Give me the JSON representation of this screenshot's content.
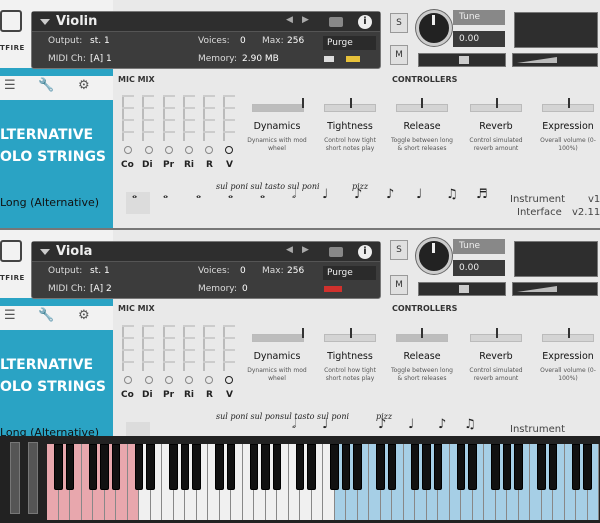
{
  "instruments": [
    {
      "name": "Violin",
      "output_label": "Output:",
      "output_value": "st. 1",
      "midi_label": "MIDI Ch:",
      "midi_value": "[A] 1",
      "voices_label": "Voices:",
      "voices_value": "0",
      "max_label": "Max:",
      "max_value": "256",
      "memory_label": "Memory:",
      "memory_value": "2.90 MB",
      "purge_label": "Purge",
      "tune_label": "Tune",
      "tune_value": "0.00",
      "solo_label": "S",
      "mute_label": "M",
      "pan_l": "L",
      "pan_r": "R",
      "mic_mix_label": "MIC MIX",
      "controllers_label": "CONTROLLERS",
      "mics": [
        "Co",
        "Di",
        "Pr",
        "Ri",
        "R",
        "V"
      ],
      "controllers": [
        {
          "name": "Dynamics",
          "desc": "Dynamics with mod wheel"
        },
        {
          "name": "Tightness",
          "desc": "Control how tight short notes play"
        },
        {
          "name": "Release",
          "desc": "Toggle between long & short releases"
        },
        {
          "name": "Reverb",
          "desc": "Control simulated reverb amount"
        },
        {
          "name": "Expression",
          "desc": "Overall volume (0-100%)"
        }
      ],
      "sidebar_title_1": "LTERNATIVE",
      "sidebar_title_2": "OLO STRINGS",
      "articulation": "Long (Alternative)",
      "art_text_1": "sul poni sul tasto sul poni",
      "art_text_2": "pizz",
      "instrument_label": "Instrument",
      "instrument_value": "v1",
      "interface_label": "Interface",
      "interface_value": "v2.11"
    },
    {
      "name": "Viola",
      "output_label": "Output:",
      "output_value": "st. 1",
      "midi_label": "MIDI Ch:",
      "midi_value": "[A] 2",
      "voices_label": "Voices:",
      "voices_value": "0",
      "max_label": "Max:",
      "max_value": "256",
      "memory_label": "Memory:",
      "memory_value": "0",
      "purge_label": "Purge",
      "tune_label": "Tune",
      "tune_value": "0.00",
      "solo_label": "S",
      "mute_label": "M",
      "pan_l": "L",
      "pan_r": "R",
      "mic_mix_label": "MIC MIX",
      "controllers_label": "CONTROLLERS",
      "mics": [
        "Co",
        "Di",
        "Pr",
        "Ri",
        "R",
        "V"
      ],
      "controllers": [
        {
          "name": "Dynamics",
          "desc": "Dynamics with mod wheel"
        },
        {
          "name": "Tightness",
          "desc": "Control how tight short notes play"
        },
        {
          "name": "Release",
          "desc": "Toggle between long & short releases"
        },
        {
          "name": "Reverb",
          "desc": "Control simulated reverb amount"
        },
        {
          "name": "Expression",
          "desc": "Overall volume (0-100%)"
        }
      ],
      "sidebar_title_1": "LTERNATIVE",
      "sidebar_title_2": "OLO STRINGS",
      "articulation": "Long (Alternative)",
      "art_text_1": "sul poni sul ponsul tasto sul poni",
      "art_text_2": "pizz",
      "instrument_label": "Instrument",
      "instrument_value": "",
      "interface_label": "",
      "interface_value": ""
    }
  ],
  "sidebar_logo_text": "TFIRE",
  "colors": {
    "sidebar": "#2aa3c4",
    "key_red": "#e8a7ad",
    "key_blue": "#a6cfe6",
    "purge_meter_on": "#e8c23a",
    "mute_red": "#d0312d"
  }
}
